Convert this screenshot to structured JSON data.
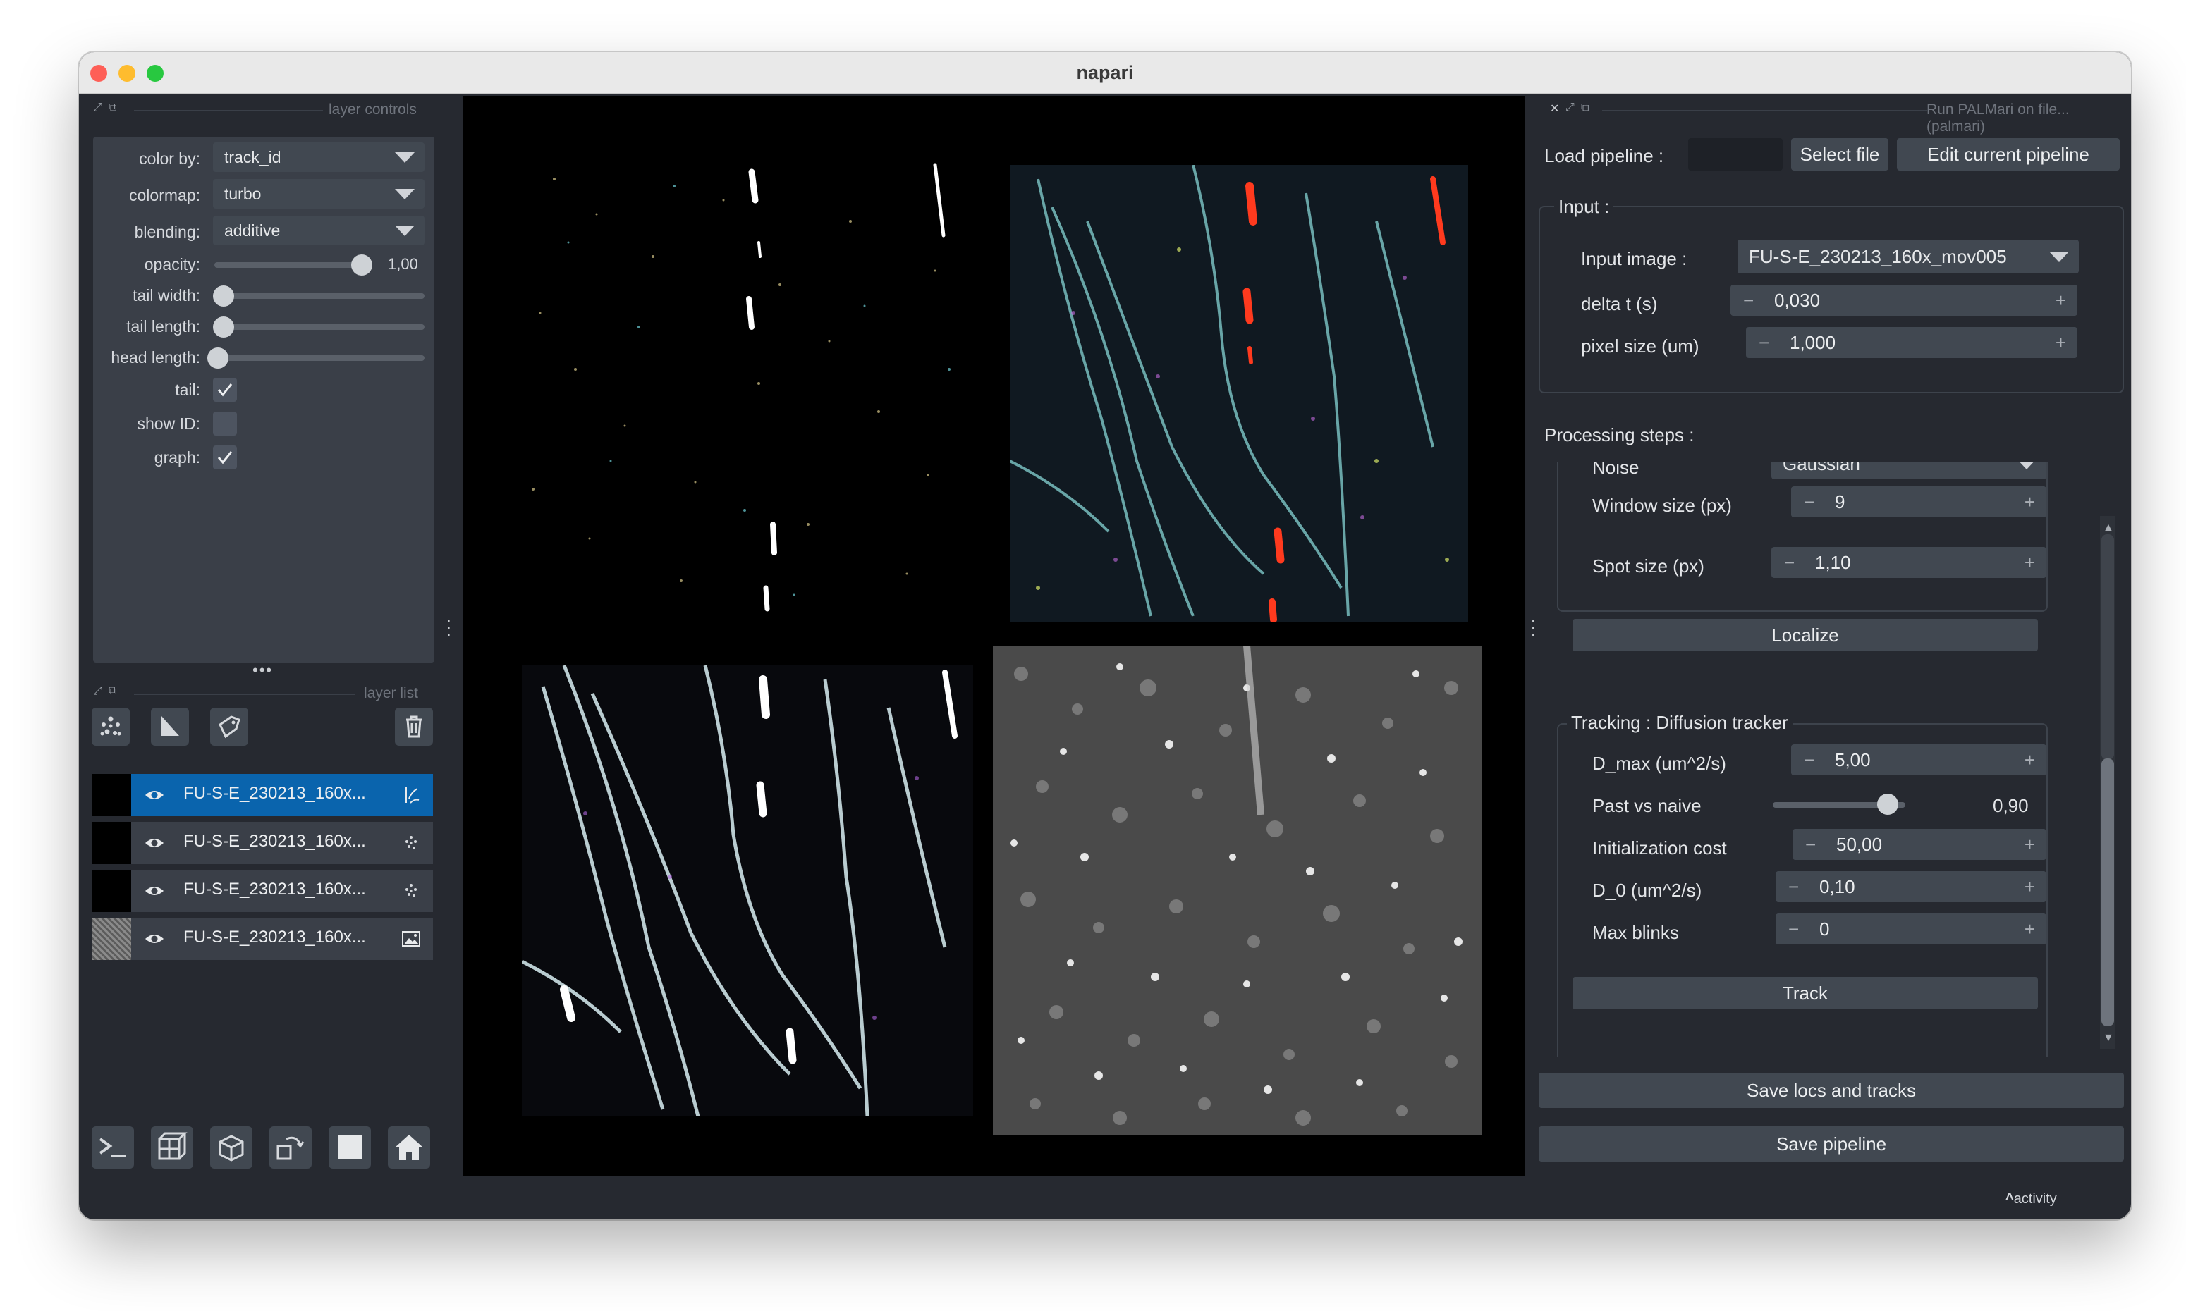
{
  "window": {
    "title": "napari"
  },
  "layer_controls": {
    "header": "layer controls",
    "color_by": {
      "label": "color by:",
      "value": "track_id"
    },
    "colormap": {
      "label": "colormap:",
      "value": "turbo"
    },
    "blending": {
      "label": "blending:",
      "value": "additive"
    },
    "opacity": {
      "label": "opacity:",
      "value": "1,00",
      "fraction": 1.0
    },
    "tail_width": {
      "label": "tail width:",
      "fraction": 0.0
    },
    "tail_length": {
      "label": "tail length:",
      "fraction": 0.0
    },
    "head_length": {
      "label": "head length:",
      "fraction": 0.0
    },
    "tail": {
      "label": "tail:",
      "checked": true
    },
    "show_id": {
      "label": "show ID:",
      "checked": false
    },
    "graph": {
      "label": "graph:",
      "checked": true
    }
  },
  "layer_list": {
    "header": "layer list",
    "layers": [
      {
        "name": "FU-S-E_230213_160x...",
        "type": "tracks-icon",
        "selected": true,
        "visible": true
      },
      {
        "name": "FU-S-E_230213_160x...",
        "type": "points-icon",
        "selected": false,
        "visible": true
      },
      {
        "name": "FU-S-E_230213_160x...",
        "type": "points-icon",
        "selected": false,
        "visible": true
      },
      {
        "name": "FU-S-E_230213_160x...",
        "type": "image-icon",
        "selected": false,
        "visible": true
      }
    ]
  },
  "plugin": {
    "title": "Run PALMari on file... (palmari)",
    "load_pipeline_label": "Load pipeline :",
    "select_file_button": "Select file",
    "edit_pipeline_button": "Edit current pipeline",
    "input_group_title": "Input :",
    "input_image": {
      "label": "Input image :",
      "value": "FU-S-E_230213_160x_mov005"
    },
    "delta_t": {
      "label": "delta t (s)",
      "value": "0,030"
    },
    "pixel_size": {
      "label": "pixel size (um)",
      "value": "1,000"
    },
    "processing_steps_label": "Processing steps :",
    "noise": {
      "label": "Noise",
      "value": "Gaussian"
    },
    "window_size": {
      "label": "Window size (px)",
      "value": "9"
    },
    "spot_size": {
      "label": "Spot size (px)",
      "value": "1,10"
    },
    "localize_button": "Localize",
    "tracking_group_title": "Tracking : Diffusion tracker",
    "d_max": {
      "label": "D_max (um^2/s)",
      "value": "5,00"
    },
    "past_vs_naive": {
      "label": "Past vs naive",
      "value": "0,90",
      "fraction": 0.9
    },
    "initialization_cost": {
      "label": "Initialization cost",
      "value": "50,00"
    },
    "d_0": {
      "label": "D_0 (um^2/s)",
      "value": "0,10"
    },
    "max_blinks": {
      "label": "Max blinks",
      "value": "0"
    },
    "track_button": "Track",
    "save_locs_button": "Save locs and tracks",
    "save_pipeline_button": "Save pipeline"
  },
  "status": {
    "activity": "activity"
  },
  "colors": {
    "selected_layer": "#0a64ad",
    "panel_bg": "#262930",
    "control_bg": "#414851",
    "canvas_bg": "#000000"
  }
}
